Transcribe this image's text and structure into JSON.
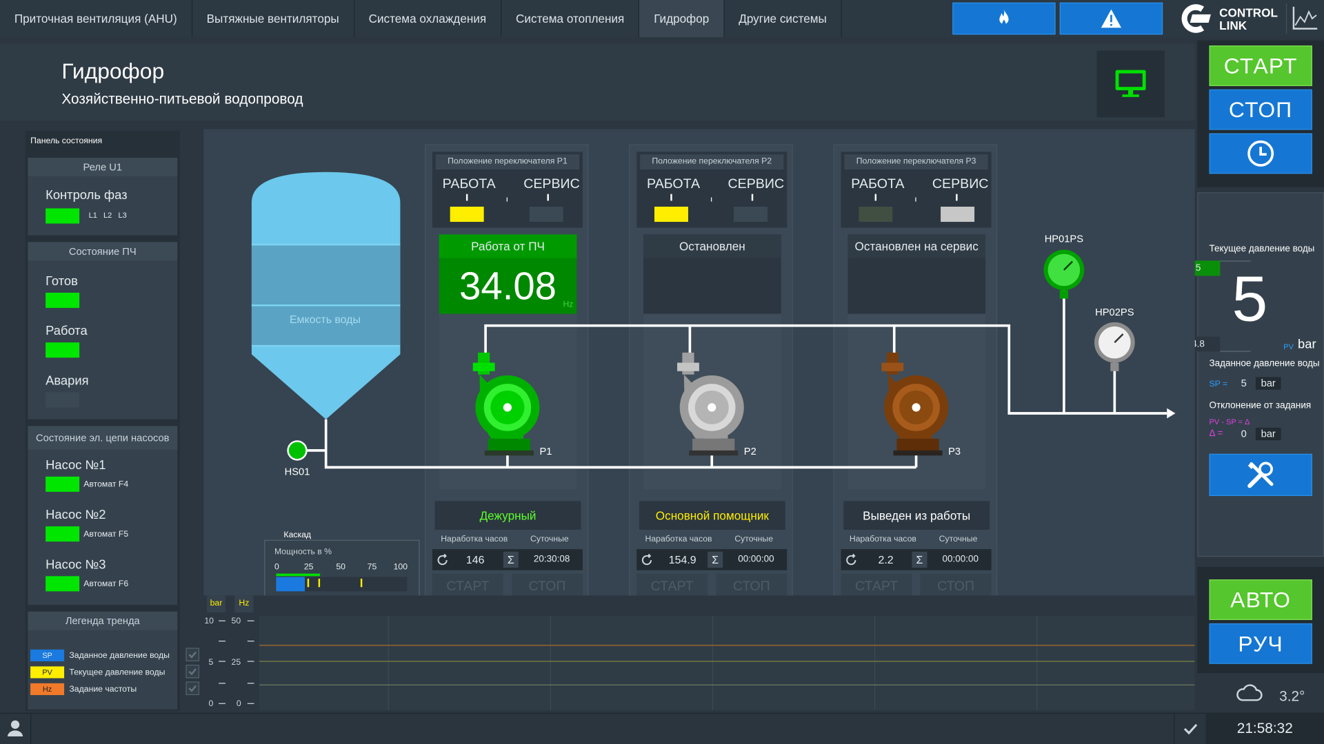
{
  "tabs": [
    {
      "label": "Приточная вентиляция (AHU)"
    },
    {
      "label": "Вытяжные вентиляторы"
    },
    {
      "label": "Система охлаждения"
    },
    {
      "label": "Система отопления"
    },
    {
      "label": "Гидрофор"
    },
    {
      "label": "Другие системы"
    }
  ],
  "brand": {
    "line1": "CONTROL",
    "line2": "LINK"
  },
  "header": {
    "title": "Гидрофор",
    "subtitle": "Хозяйственно-питьевой водопровод"
  },
  "controls": {
    "start": "СТАРТ",
    "stop": "СТОП",
    "auto": "АВТО",
    "manual": "РУЧ"
  },
  "status_panel": {
    "title": "Панель состояния",
    "relay": {
      "title": "Реле U1",
      "phase_label": "Контроль фаз",
      "phases": "L1   L2   L3"
    },
    "vfd": {
      "title": "Состояние ПЧ",
      "ready": "Готов",
      "run": "Работа",
      "alarm": "Авария"
    },
    "pumps_title": "Состояние эл. цепи насосов",
    "pumps": [
      {
        "name": "Насос №1",
        "breaker": "Автомат F4"
      },
      {
        "name": "Насос №2",
        "breaker": "Автомат F5"
      },
      {
        "name": "Насос №3",
        "breaker": "Автомат F6"
      }
    ],
    "legend_title": "Легенда тренда",
    "legend": [
      {
        "tag": "SP",
        "label": "Заданное давление воды",
        "color": "#1a7ae0"
      },
      {
        "tag": "PV",
        "label": "Текущее давление воды",
        "color": "#ffee00"
      },
      {
        "tag": "Hz",
        "label": "Задание частоты",
        "color": "#f07a2a"
      }
    ]
  },
  "tank": {
    "label": "Емкость воды",
    "sensor": "HS01"
  },
  "cascade": {
    "title": "Каскад",
    "power_label": "Мощность в %",
    "ticks": [
      "0",
      "25",
      "50",
      "75",
      "100"
    ]
  },
  "pumps": [
    {
      "switch_title": "Положение переключателя P1",
      "work": "РАБОТА",
      "service": "СЕРВИС",
      "state": "Работа от ПЧ",
      "freq": "34.08",
      "unit": "Hz",
      "role": "Дежурный",
      "hours_label": "Наработка часов",
      "daily_label": "Суточные",
      "hours": "146",
      "daily": "20:30:08",
      "start": "СТАРТ",
      "stop": "СТОП",
      "tag": "P1",
      "color": "#00d000"
    },
    {
      "switch_title": "Положение переключателя P2",
      "work": "РАБОТА",
      "service": "СЕРВИС",
      "state": "Остановлен",
      "freq": "",
      "unit": "",
      "role": "Основной помощник",
      "hours_label": "Наработка часов",
      "daily_label": "Суточные",
      "hours": "154.9",
      "daily": "00:00:00",
      "start": "СТАРТ",
      "stop": "СТОП",
      "tag": "P2",
      "color": "#b0b0b0"
    },
    {
      "switch_title": "Положение переключателя P3",
      "work": "РАБОТА",
      "service": "СЕРВИС",
      "state": "Остановлен на сервис",
      "freq": "",
      "unit": "",
      "role": "Выведен из работы",
      "hours_label": "Наработка часов",
      "daily_label": "Суточные",
      "hours": "2.2",
      "daily": "00:00:00",
      "start": "СТАРТ",
      "stop": "СТОП",
      "tag": "P3",
      "color": "#8a4a10"
    }
  ],
  "sigma": "Σ",
  "gauges": [
    {
      "tag": "HP01PS"
    },
    {
      "tag": "HP02PS"
    }
  ],
  "pressure": {
    "title": "Текущее давление воды",
    "value": "5",
    "unit": "bar",
    "pv": "PV",
    "high": "5",
    "low": "4.8",
    "sp_title": "Заданное давление воды",
    "sp_label": "SP =",
    "sp_value": "5",
    "sp_unit": "bar",
    "dev_title": "Отклонение от задания",
    "dev_formula": "PV - SP = Δ",
    "dev_label": "Δ =",
    "dev_value": "0",
    "dev_unit": "bar"
  },
  "trend": {
    "left_unit": "bar",
    "right_unit": "Hz",
    "left_ticks": [
      "10",
      "5",
      "0"
    ],
    "right_ticks": [
      "50",
      "25",
      "0"
    ]
  },
  "weather": {
    "temp": "3.2°"
  },
  "footer": {
    "time": "21:58:32"
  }
}
